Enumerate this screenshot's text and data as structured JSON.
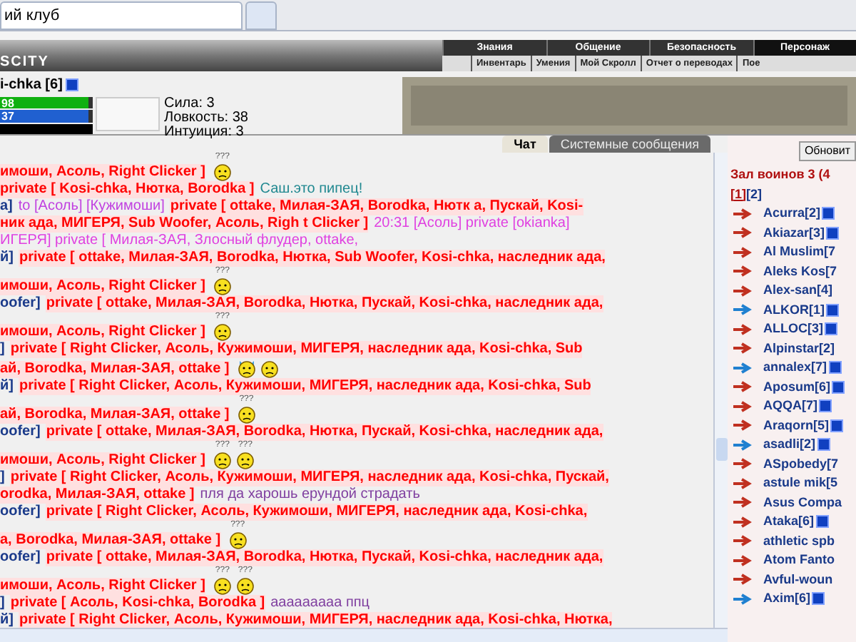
{
  "browser_tabs": [
    {
      "label": "ий клуб",
      "selected": true
    },
    {
      "selected": false
    }
  ],
  "header": {
    "logo": "SCITY",
    "menu_top": [
      "Знания",
      "Общение",
      "Безопасность",
      "Персонаж"
    ],
    "menu_sub": [
      "Инвентарь",
      "Умения",
      "Мой Скролл",
      "Отчет о переводах",
      "Пое"
    ]
  },
  "character": {
    "name": "i-chka [6]",
    "bars": [
      {
        "label": "98",
        "level": 0.96,
        "color": "#10b010"
      },
      {
        "label": "37",
        "level": 0.96,
        "color": "#2060d0"
      }
    ],
    "stats": [
      "Сила: 3",
      "Ловкость: 38",
      "Интуиция: 3"
    ]
  },
  "chat_tabs": [
    {
      "label": "Чат",
      "selected": true
    },
    {
      "label": "Системные сообщения",
      "selected": false
    }
  ],
  "chat_lines": [
    [
      {
        "kind": "private",
        "text": "имоши, Асоль, Right Clicker ]"
      },
      {
        "kind": "smiley",
        "text": "???"
      }
    ],
    [
      {
        "kind": "private",
        "text": "private [ Kosi-chka, Нютка, Borodka ]"
      },
      {
        "kind": "message",
        "text": "Саш.это пипец!",
        "color": "#208890"
      }
    ],
    [
      {
        "kind": "nick",
        "text": "a]"
      },
      {
        "kind": "message",
        "text": "to [Асоль] [Кужимоши]",
        "color": "#c040e0"
      },
      {
        "kind": "private",
        "text": "private [ ottake, Милая-ЗАЯ, Borodka, Нютк а, Пускай, Kosi-"
      }
    ],
    [
      {
        "kind": "private",
        "text": "ник ада, МИГЕРЯ, Sub Woofer, Асоль, Righ t Clicker ]"
      },
      {
        "kind": "message",
        "text": "20:31 [Асоль] private [okianka]",
        "color": "#e040e0"
      }
    ],
    [
      {
        "kind": "message",
        "text": "ИГЕРЯ] private [ Милая-ЗАЯ, Злосный флудер, ottake,",
        "color": "#e040e0"
      }
    ],
    [
      {
        "kind": "nick",
        "text": "й]"
      },
      {
        "kind": "private",
        "text": "private [ ottake, Милая-ЗАЯ, Borodka, Нютка, Sub Woofer, Kosi-chka, наследник ада,"
      }
    ],
    [
      {
        "kind": "private",
        "text": "имоши, Асоль, Right Clicker ]"
      },
      {
        "kind": "smiley",
        "text": "???"
      }
    ],
    [
      {
        "kind": "nick",
        "text": "oofer]"
      },
      {
        "kind": "private",
        "text": "private [ ottake, Милая-ЗАЯ, Borodka, Нютка, Пускай, Kosi-chka, наследник ада,"
      }
    ],
    [
      {
        "kind": "private",
        "text": "имоши, Асоль, Right Clicker ]"
      },
      {
        "kind": "smiley",
        "text": "???"
      }
    ],
    [
      {
        "kind": "nick",
        "text": "]"
      },
      {
        "kind": "private",
        "text": "private [ Right Clicker, Асоль, Кужимоши, МИГЕРЯ, наследник ада, Kosi-chka, Sub"
      }
    ],
    [
      {
        "kind": "private",
        "text": "ай, Borodka, Милая-ЗАЯ, ottake ]"
      },
      {
        "kind": "cat"
      },
      {
        "kind": "smiley"
      }
    ],
    [
      {
        "kind": "nick",
        "text": "й]"
      },
      {
        "kind": "private",
        "text": "private [ Right Clicker, Асоль, Кужимоши, МИГЕРЯ, наследник ада, Kosi-chka, Sub"
      }
    ],
    [
      {
        "kind": "private",
        "text": "ай, Borodka, Милая-ЗАЯ, ottake ]"
      },
      {
        "kind": "smiley",
        "text": "???"
      }
    ],
    [
      {
        "kind": "nick",
        "text": "oofer]"
      },
      {
        "kind": "private",
        "text": "private [ ottake, Милая-ЗАЯ, Borodka, Нютка, Пускай, Kosi-chka, наследник ада,"
      }
    ],
    [
      {
        "kind": "private",
        "text": "имоши, Асоль, Right Clicker ]"
      },
      {
        "kind": "smiley",
        "text": "???"
      },
      {
        "kind": "smiley",
        "text": "???"
      }
    ],
    [
      {
        "kind": "nick",
        "text": "]"
      },
      {
        "kind": "private",
        "text": "private [ Right Clicker, Асоль, Кужимоши, МИГЕРЯ, наследник ада, Kosi-chka, Пускай,"
      }
    ],
    [
      {
        "kind": "private",
        "text": "orodka, Милая-ЗАЯ, ottake ]"
      },
      {
        "kind": "message",
        "text": "пля да харошь ерундой страдать",
        "color": "#8040a0"
      }
    ],
    [
      {
        "kind": "nick",
        "text": "oofer]"
      },
      {
        "kind": "private",
        "text": "private [ Right Clicker, Асоль, Кужимоши, МИГЕРЯ, наследник ада, Kosi-chka,"
      }
    ],
    [
      {
        "kind": "private",
        "text": "a, Borodka, Милая-ЗАЯ, ottake ]"
      },
      {
        "kind": "smiley",
        "text": "???"
      }
    ],
    [
      {
        "kind": "nick",
        "text": "oofer]"
      },
      {
        "kind": "private",
        "text": "private [ ottake, Милая-ЗАЯ, Borodka, Нютка, Пускай, Kosi-chka, наследник ада,"
      }
    ],
    [
      {
        "kind": "private",
        "text": "имоши, Асоль, Right Clicker ]"
      },
      {
        "kind": "smiley",
        "text": "???"
      },
      {
        "kind": "smiley",
        "text": "???"
      }
    ],
    [
      {
        "kind": "nick",
        "text": "]"
      },
      {
        "kind": "private",
        "text": "private [ Асоль, Kosi-chka, Borodka ]"
      },
      {
        "kind": "message",
        "text": "ааааааааа ппц",
        "color": "#8040a0"
      }
    ],
    [
      {
        "kind": "nick",
        "text": "й]"
      },
      {
        "kind": "private",
        "text": "private [ Right Clicker, Асоль, Кужимоши, МИГЕРЯ, наследник ада, Kosi-chka, Нютка,"
      }
    ]
  ],
  "room": {
    "refresh_button": "Обновит",
    "title": "Зал воинов 3 (4",
    "pages": [
      {
        "label": "[1]",
        "selected": true
      },
      {
        "label": "[2]",
        "selected": false
      }
    ],
    "players": [
      {
        "name": "Acurra[2]",
        "color": "#c03020",
        "info": true
      },
      {
        "name": "Akiazar[3]",
        "color": "#c03020",
        "info": true
      },
      {
        "name": "Al Muslim[7",
        "color": "#c03020",
        "info": false
      },
      {
        "name": "Aleks Kos[7",
        "color": "#c03020",
        "info": false
      },
      {
        "name": "Alex-san[4]",
        "color": "#c03020",
        "info": false
      },
      {
        "name": "ALKOR[1]",
        "color": "#2080d0",
        "info": true
      },
      {
        "name": "ALLOC[3]",
        "color": "#c03020",
        "info": true
      },
      {
        "name": "Alpinstar[2]",
        "color": "#c03020",
        "info": false
      },
      {
        "name": "annalex[7]",
        "color": "#2080d0",
        "info": true
      },
      {
        "name": "Aposum[6]",
        "color": "#c03020",
        "info": true
      },
      {
        "name": "AQQA[7]",
        "color": "#c03020",
        "info": true
      },
      {
        "name": "Araqorn[5]",
        "color": "#c03020",
        "info": true
      },
      {
        "name": "asadli[2]",
        "color": "#2080d0",
        "info": true
      },
      {
        "name": "ASpobedy[7",
        "color": "#c03020",
        "info": false
      },
      {
        "name": "astule mik[5",
        "color": "#c03020",
        "info": false
      },
      {
        "name": "Asus Compa",
        "color": "#c03020",
        "info": false
      },
      {
        "name": "Ataka[6]",
        "color": "#c03020",
        "info": true
      },
      {
        "name": "athletic spb",
        "color": "#c03020",
        "info": false
      },
      {
        "name": "Atom Fanto",
        "color": "#c03020",
        "info": false
      },
      {
        "name": "Avful-woun",
        "color": "#c03020",
        "info": false
      },
      {
        "name": "Axim[6]",
        "color": "#2080d0",
        "info": true
      }
    ]
  }
}
